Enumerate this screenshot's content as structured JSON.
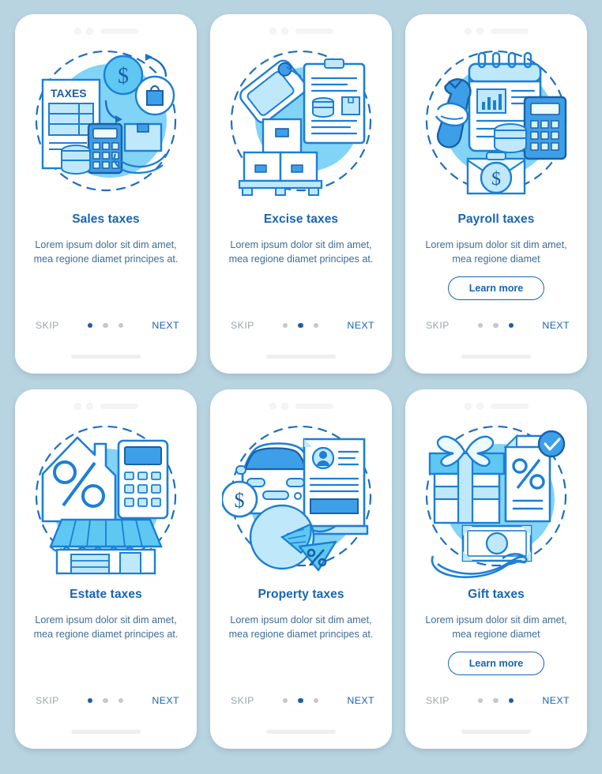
{
  "background_color": "#b9d4e1",
  "colors": {
    "title": "#1765b4",
    "body": "#3f6d94",
    "skip": "#9aa6ad",
    "next": "#1765b4",
    "pip_active": "#1d5dad",
    "pip_inactive": "#c3c9cd",
    "accent_line": "#1c7fd6",
    "accent_fill_light": "#bfe9fb",
    "accent_fill_mid": "#5ec8f2",
    "accent_fill_blue": "#3d9fe8"
  },
  "common": {
    "skip_label": "SKIP",
    "next_label": "NEXT",
    "learn_more_label": "Learn more",
    "pip_count": 3
  },
  "screens": [
    {
      "id": "sales-taxes",
      "title": "Sales taxes",
      "body": "Lorem ipsum dolor sit dim amet, mea regione diamet principes at.",
      "has_learn_more": false,
      "active_pip": 0,
      "illustration": "sales-taxes-illustration",
      "icon_elements": [
        "taxes-form-icon",
        "dollar-coin-icon",
        "shopping-bag-icon",
        "calculator-icon",
        "coin-stack-icon",
        "parcel-on-hand-icon"
      ]
    },
    {
      "id": "excise-taxes",
      "title": "Excise taxes",
      "body": "Lorem ipsum dolor sit dim amet, mea regione diamet principes at.",
      "has_learn_more": false,
      "active_pip": 1,
      "illustration": "excise-taxes-illustration",
      "icon_elements": [
        "price-tag-icon",
        "clipboard-document-icon",
        "coin-stack-icon",
        "box-icon",
        "pallet-boxes-icon"
      ]
    },
    {
      "id": "payroll-taxes",
      "title": "Payroll taxes",
      "body": "Lorem ipsum dolor sit dim amet, mea regione diamet",
      "has_learn_more": true,
      "active_pip": 2,
      "illustration": "payroll-taxes-illustration",
      "icon_elements": [
        "wrench-in-hand-icon",
        "calendar-report-icon",
        "calculator-icon",
        "coin-stack-icon",
        "briefcase-dollar-icon"
      ]
    },
    {
      "id": "estate-taxes",
      "title": "Estate taxes",
      "body": "Lorem ipsum dolor sit dim amet, mea regione diamet principes at.",
      "has_learn_more": false,
      "active_pip": 0,
      "illustration": "estate-taxes-illustration",
      "icon_elements": [
        "house-percent-icon",
        "calculator-icon",
        "storefront-icon"
      ]
    },
    {
      "id": "property-taxes",
      "title": "Property taxes",
      "body": "Lorem ipsum dolor sit dim amet, mea regione diamet principes at.",
      "has_learn_more": false,
      "active_pip": 1,
      "illustration": "property-taxes-illustration",
      "icon_elements": [
        "car-icon",
        "dollar-coin-icon",
        "id-document-icon",
        "pie-chart-percent-icon"
      ]
    },
    {
      "id": "gift-taxes",
      "title": "Gift taxes",
      "body": "Lorem ipsum dolor sit dim amet, mea regione diamet",
      "has_learn_more": true,
      "active_pip": 2,
      "illustration": "gift-taxes-illustration",
      "icon_elements": [
        "gift-box-icon",
        "percent-document-check-icon",
        "banknote-on-hand-icon"
      ]
    }
  ]
}
